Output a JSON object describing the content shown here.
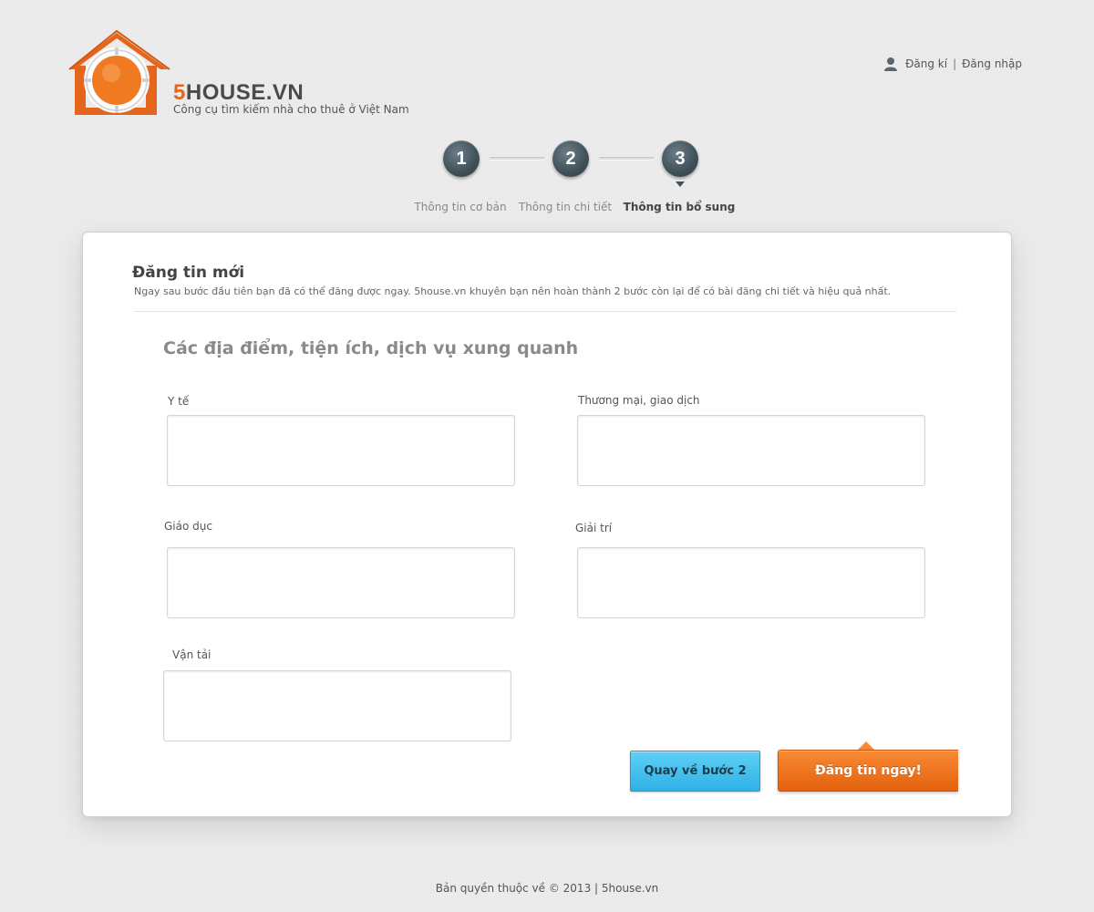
{
  "brand": {
    "name_prefix": "5",
    "name_rest": "HOUSE.VN",
    "tagline": "Công cụ tìm kiếm nhà cho thuê ở Việt Nam",
    "logo_icon": "house-target-icon",
    "accent_color": "#e5651c"
  },
  "auth": {
    "icon": "user-icon",
    "register": "Đăng kí",
    "separator": "|",
    "login": "Đăng nhập"
  },
  "steps": [
    {
      "number": "1",
      "label": "Thông tin cơ bản",
      "active": false
    },
    {
      "number": "2",
      "label": "Thông tin chi tiết",
      "active": false
    },
    {
      "number": "3",
      "label": "Thông tin bổ sung",
      "active": true
    }
  ],
  "card": {
    "title": "Đăng tin mới",
    "description": "Ngay sau bước đầu tiên bạn đã có thể đăng được ngay. 5house.vn khuyên bạn nên hoàn thành 2 bước còn lại để có bài đăng chi tiết và hiệu quả nhất.",
    "section_title": "Các địa điểm, tiện ích, dịch vụ xung quanh",
    "fields": [
      {
        "label": "Y tế",
        "value": ""
      },
      {
        "label": "Thương mại, giao dịch",
        "value": ""
      },
      {
        "label": "Giáo dục",
        "value": ""
      },
      {
        "label": "Giải trí",
        "value": ""
      },
      {
        "label": "Vận tải",
        "value": ""
      }
    ],
    "back_button": "Quay về bước 2",
    "submit_button": "Đăng tin ngay!",
    "back_color": "#2fb1e6",
    "submit_color": "#e4620e"
  },
  "footer": {
    "text": "Bản quyền thuộc về © 2013 | 5house.vn"
  }
}
